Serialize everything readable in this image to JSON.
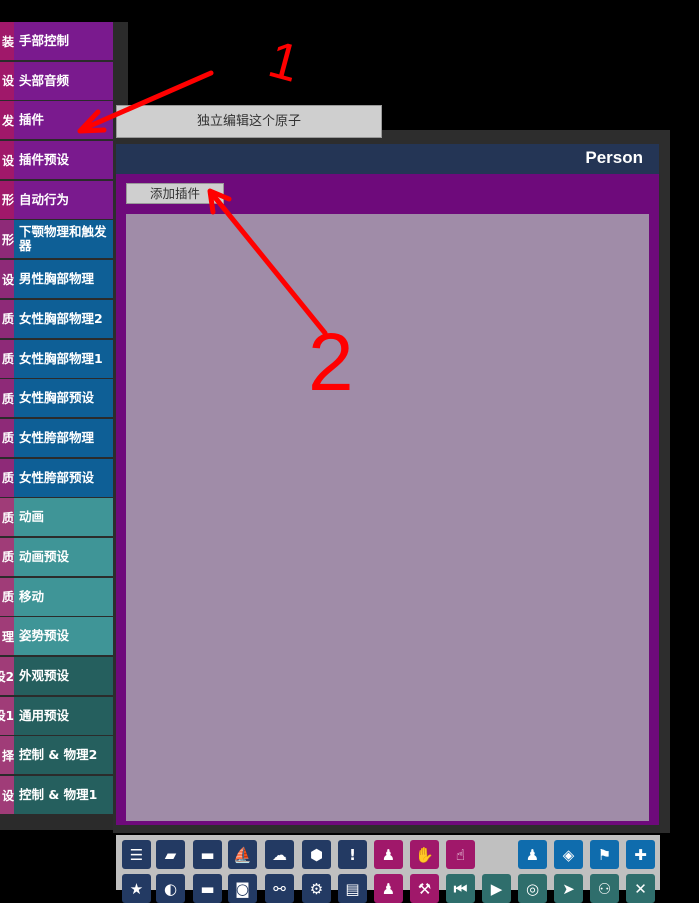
{
  "left_panel": {
    "category_fragments": [
      "装",
      "设",
      "发",
      "设",
      "形",
      "形",
      "设",
      "质",
      "质",
      "质",
      "质",
      "质",
      "质",
      "质",
      "质",
      "理",
      "设2",
      "设1",
      "择",
      "设"
    ],
    "tabs": [
      {
        "label": "手部控制",
        "color": "purple"
      },
      {
        "label": "头部音频",
        "color": "purple"
      },
      {
        "label": "插件",
        "color": "purple"
      },
      {
        "label": "插件预设",
        "color": "purple"
      },
      {
        "label": "自动行为",
        "color": "purple"
      },
      {
        "label": "下颚物理和触发器",
        "color": "blue"
      },
      {
        "label": "男性胸部物理",
        "color": "blue"
      },
      {
        "label": "女性胸部物理2",
        "color": "blue"
      },
      {
        "label": "女性胸部物理1",
        "color": "blue"
      },
      {
        "label": "女性胸部预设",
        "color": "blue"
      },
      {
        "label": "女性胯部物理",
        "color": "blue"
      },
      {
        "label": "女性胯部预设",
        "color": "blue"
      },
      {
        "label": "动画",
        "color": "teal"
      },
      {
        "label": "动画预设",
        "color": "teal"
      },
      {
        "label": "移动",
        "color": "teal"
      },
      {
        "label": "姿势预设",
        "color": "teal"
      },
      {
        "label": "外观预设",
        "color": "dark"
      },
      {
        "label": "通用预设",
        "color": "dark"
      },
      {
        "label": "控制 & 物理2",
        "color": "dark"
      },
      {
        "label": "控制 & 物理1",
        "color": "dark"
      }
    ]
  },
  "tooltip": {
    "text": "独立编辑这个原子"
  },
  "main": {
    "title": "Person",
    "add_plugin_label": "添加插件"
  },
  "annotations": [
    "1",
    "2"
  ],
  "toolbar": {
    "row1": [
      {
        "icon": "menu-icon",
        "color": "navy",
        "glyph": "☰"
      },
      {
        "icon": "open-scene-icon",
        "color": "navy",
        "glyph": "▰"
      },
      {
        "icon": "folder-icon",
        "color": "navy",
        "glyph": "▬"
      },
      {
        "icon": "ship-icon",
        "color": "navy",
        "glyph": "⛵"
      },
      {
        "icon": "cloud-download-icon",
        "color": "navy",
        "glyph": "☁"
      },
      {
        "icon": "package-icon",
        "color": "navy",
        "glyph": "⬢"
      },
      {
        "icon": "alert-icon",
        "color": "navy",
        "glyph": "!"
      },
      {
        "icon": "add-person-icon",
        "color": "mag",
        "glyph": "♟"
      },
      {
        "icon": "hand-icon",
        "color": "mag",
        "glyph": "✋"
      },
      {
        "icon": "touch-icon",
        "color": "mag",
        "glyph": "☝"
      },
      {
        "icon": "person-icon",
        "color": "bl",
        "glyph": "♟"
      },
      {
        "icon": "unity-icon",
        "color": "bl",
        "glyph": "◈"
      },
      {
        "icon": "flag-icon",
        "color": "bl",
        "glyph": "⚑"
      },
      {
        "icon": "plus-icon",
        "color": "bl",
        "glyph": "✚"
      }
    ],
    "row2": [
      {
        "icon": "star-icon",
        "color": "navy",
        "glyph": "★"
      },
      {
        "icon": "palette-icon",
        "color": "navy",
        "glyph": "◐"
      },
      {
        "icon": "folder-open-icon",
        "color": "navy",
        "glyph": "▬"
      },
      {
        "icon": "camera-icon",
        "color": "navy",
        "glyph": "◙"
      },
      {
        "icon": "link-icon",
        "color": "navy",
        "glyph": "⚯"
      },
      {
        "icon": "settings-icon",
        "color": "navy",
        "glyph": "⚙"
      },
      {
        "icon": "document-icon",
        "color": "navy",
        "glyph": "▤"
      },
      {
        "icon": "person-outline-icon",
        "color": "mag",
        "glyph": "♟"
      },
      {
        "icon": "wrench-icon",
        "color": "mag",
        "glyph": "⚒"
      },
      {
        "icon": "skip-back-icon",
        "color": "tl",
        "glyph": "⏮"
      },
      {
        "icon": "play-icon",
        "color": "tl",
        "glyph": "▶"
      },
      {
        "icon": "target-icon",
        "color": "tl",
        "glyph": "◎"
      },
      {
        "icon": "cursor-icon",
        "color": "tl",
        "glyph": "➤"
      },
      {
        "icon": "group-icon",
        "color": "tl",
        "glyph": "⚇"
      },
      {
        "icon": "tools-icon",
        "color": "tl",
        "glyph": "✕"
      }
    ]
  }
}
